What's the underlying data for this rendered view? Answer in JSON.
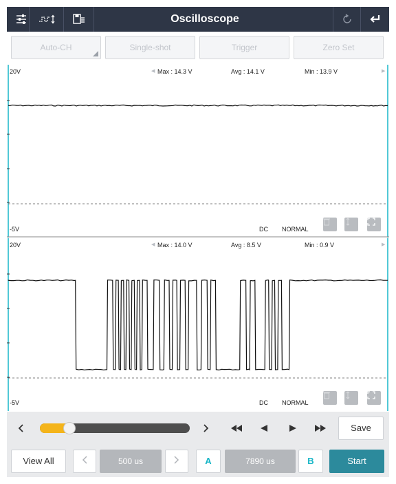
{
  "header": {
    "title": "Oscilloscope",
    "icons": [
      "settings-sliders-icon",
      "waveform-adjust-icon",
      "save-data-icon",
      "refresh-icon",
      "back-icon"
    ]
  },
  "mode_buttons": {
    "auto_ch": "Auto-CH",
    "single_shot": "Single-shot",
    "trigger": "Trigger",
    "zero_set": "Zero Set"
  },
  "channels": [
    {
      "scale_top": "20V",
      "scale_bottom": "-5V",
      "max": "Max : 14.3 V",
      "avg": "Avg : 14.1 V",
      "min": "Min : 13.9 V",
      "coupling": "DC",
      "mode": "NORMAL",
      "signal": {
        "type": "flat",
        "level_v": 14.1
      }
    },
    {
      "scale_top": "20V",
      "scale_bottom": "-5V",
      "max": "Max : 14.0 V",
      "avg": "Avg : 8.5 V",
      "min": "Min : 0.9 V",
      "coupling": "DC",
      "mode": "NORMAL",
      "signal": {
        "type": "pulse",
        "high_v": 13.9,
        "low_v": 1.0,
        "low_segments": [
          [
            0.177,
            0.26
          ],
          [
            0.275,
            0.282
          ],
          [
            0.29,
            0.296
          ],
          [
            0.304,
            0.31
          ],
          [
            0.318,
            0.324
          ],
          [
            0.332,
            0.338
          ],
          [
            0.346,
            0.352
          ],
          [
            0.366,
            0.382
          ],
          [
            0.398,
            0.41
          ],
          [
            0.424,
            0.432
          ],
          [
            0.444,
            0.452
          ],
          [
            0.466,
            0.474
          ],
          [
            0.496,
            0.508
          ],
          [
            0.524,
            0.532
          ],
          [
            0.546,
            0.61
          ],
          [
            0.626,
            0.636
          ],
          [
            0.65,
            0.676
          ],
          [
            0.686,
            0.694
          ],
          [
            0.702,
            0.71
          ],
          [
            0.72,
            0.74
          ]
        ]
      }
    }
  ],
  "timeline": {
    "slider_position": 0.17,
    "save_label": "Save"
  },
  "bottom": {
    "view_all": "View All",
    "timebase": "500 us",
    "marker_a": "A",
    "delta": "7890 us",
    "marker_b": "B",
    "start": "Start"
  },
  "colors": {
    "header_bg": "#2e3646",
    "cursor_line": "#17b6c9",
    "start_bg": "#2c8a9c",
    "slider_fill": "#f4b41a"
  }
}
